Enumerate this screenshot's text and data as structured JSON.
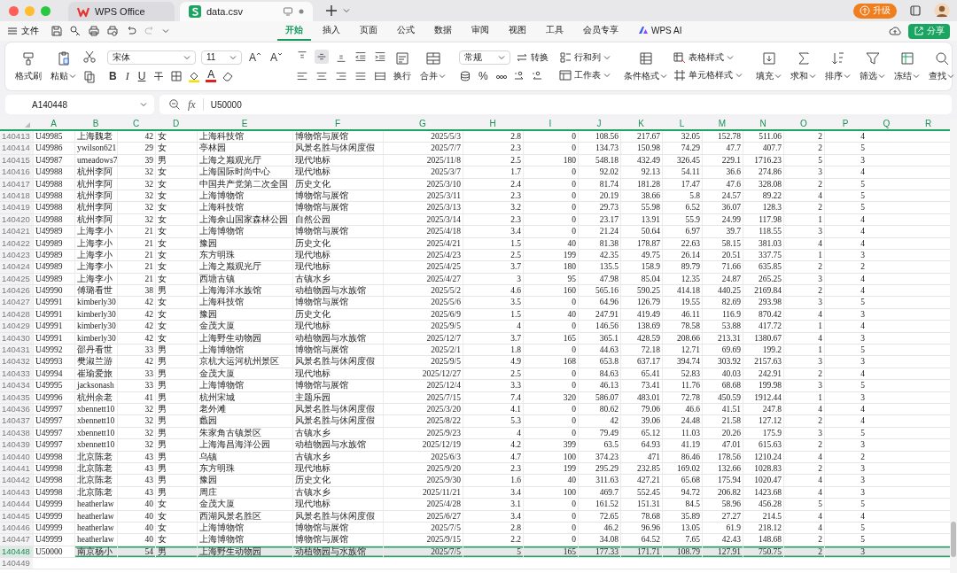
{
  "title_tabs": [
    {
      "label": "WPS Office",
      "selected": false
    },
    {
      "label": "data.csv",
      "selected": true
    }
  ],
  "upgrade": "升级",
  "menu": {
    "file": "文件",
    "tabs": [
      {
        "label": "开始",
        "selected": true
      },
      {
        "label": "插入",
        "selected": false
      },
      {
        "label": "页面",
        "selected": false
      },
      {
        "label": "公式",
        "selected": false
      },
      {
        "label": "数据",
        "selected": false
      },
      {
        "label": "审阅",
        "selected": false
      },
      {
        "label": "视图",
        "selected": false
      },
      {
        "label": "工具",
        "selected": false
      },
      {
        "label": "会员专享",
        "selected": false
      },
      {
        "label": "WPS AI",
        "selected": false
      }
    ],
    "share": "分享"
  },
  "ribbon": {
    "format_painter": "格式刷",
    "paste": "粘贴",
    "font": "宋体",
    "font_size": "11",
    "font_grow": "A",
    "font_shrink": "A",
    "bold": "B",
    "italic": "I",
    "underline": "U",
    "font_color": "A",
    "alignment": [
      {
        "selected": false
      },
      {
        "selected": true
      },
      {
        "selected": false
      },
      {
        "selected": false
      },
      {
        "selected": false
      },
      {
        "selected": false
      },
      {
        "selected": false
      },
      {
        "selected": false
      },
      {
        "selected": false
      },
      {
        "selected": false
      }
    ],
    "wrap": "换行",
    "merge": "合并",
    "number_format": "常规",
    "convert": "转换",
    "percent": "%",
    "rows_cols": "行和列",
    "worksheet": "工作表",
    "cond_format": "条件格式",
    "table_style": "表格样式",
    "cell_style": "单元格样式",
    "fill": "填充",
    "sum": "求和",
    "sort": "排序",
    "filter": "筛选",
    "freeze": "冻结",
    "find": "查找"
  },
  "formula_bar": {
    "cell_ref": "A140448",
    "fx": "fx",
    "value": "U50000"
  },
  "sheet": {
    "columns": [
      "A",
      "B",
      "C",
      "D",
      "E",
      "F",
      "G",
      "H",
      "I",
      "J",
      "K",
      "L",
      "M",
      "N",
      "O",
      "P",
      "Q",
      "R"
    ],
    "rows": [
      {
        "num": "140413",
        "selected": false,
        "cells": [
          "U49985",
          "上海魏老",
          "42",
          "女",
          "上海科技馆",
          "博物馆与展馆",
          "2025/5/3",
          "2.8",
          "0",
          "108.56",
          "217.67",
          "32.05",
          "152.78",
          "511.06",
          "2",
          "4"
        ]
      },
      {
        "num": "140414",
        "selected": false,
        "cells": [
          "U49986",
          "ywilson621",
          "29",
          "女",
          "亭林园",
          "风景名胜与休闲度假",
          "2025/7/7",
          "2.3",
          "0",
          "134.73",
          "150.98",
          "74.29",
          "47.7",
          "407.7",
          "2",
          "5"
        ]
      },
      {
        "num": "140415",
        "selected": false,
        "cells": [
          "U49987",
          "umeadows7",
          "39",
          "男",
          "上海之巅观光厅",
          "现代地标",
          "2025/11/8",
          "2.5",
          "180",
          "548.18",
          "432.49",
          "326.45",
          "229.1",
          "1716.23",
          "5",
          "3"
        ]
      },
      {
        "num": "140416",
        "selected": false,
        "cells": [
          "U49988",
          "杭州李阿",
          "32",
          "女",
          "上海国际时尚中心",
          "现代地标",
          "2025/3/7",
          "1.7",
          "0",
          "92.02",
          "92.13",
          "54.11",
          "36.6",
          "274.86",
          "3",
          "4"
        ]
      },
      {
        "num": "140417",
        "selected": false,
        "cells": [
          "U49988",
          "杭州李阿",
          "32",
          "女",
          "中国共产党第二次全国",
          "历史文化",
          "2025/3/10",
          "2.4",
          "0",
          "81.74",
          "181.28",
          "17.47",
          "47.6",
          "328.08",
          "2",
          "5"
        ]
      },
      {
        "num": "140418",
        "selected": false,
        "cells": [
          "U49988",
          "杭州李阿",
          "32",
          "女",
          "上海博物馆",
          "博物馆与展馆",
          "2025/3/11",
          "2.3",
          "0",
          "20.19",
          "38.66",
          "5.8",
          "24.57",
          "89.22",
          "4",
          "5"
        ]
      },
      {
        "num": "140419",
        "selected": false,
        "cells": [
          "U49988",
          "杭州李阿",
          "32",
          "女",
          "上海科技馆",
          "博物馆与展馆",
          "2025/3/13",
          "3.2",
          "0",
          "29.73",
          "55.98",
          "6.52",
          "36.07",
          "128.3",
          "2",
          "5"
        ]
      },
      {
        "num": "140420",
        "selected": false,
        "cells": [
          "U49988",
          "杭州李阿",
          "32",
          "女",
          "上海佘山国家森林公园",
          "自然公园",
          "2025/3/14",
          "2.3",
          "0",
          "23.17",
          "13.91",
          "55.9",
          "24.99",
          "117.98",
          "1",
          "4"
        ]
      },
      {
        "num": "140421",
        "selected": false,
        "cells": [
          "U49989",
          "上海李小",
          "21",
          "女",
          "上海博物馆",
          "博物馆与展馆",
          "2025/4/18",
          "3.4",
          "0",
          "21.24",
          "50.64",
          "6.97",
          "39.7",
          "118.55",
          "3",
          "4"
        ]
      },
      {
        "num": "140422",
        "selected": false,
        "cells": [
          "U49989",
          "上海李小",
          "21",
          "女",
          "豫园",
          "历史文化",
          "2025/4/21",
          "1.5",
          "40",
          "81.38",
          "178.87",
          "22.63",
          "58.15",
          "381.03",
          "4",
          "4"
        ]
      },
      {
        "num": "140423",
        "selected": false,
        "cells": [
          "U49989",
          "上海李小",
          "21",
          "女",
          "东方明珠",
          "现代地标",
          "2025/4/23",
          "2.5",
          "199",
          "42.35",
          "49.75",
          "26.14",
          "20.51",
          "337.75",
          "1",
          "3"
        ]
      },
      {
        "num": "140424",
        "selected": false,
        "cells": [
          "U49989",
          "上海李小",
          "21",
          "女",
          "上海之巅观光厅",
          "现代地标",
          "2025/4/25",
          "3.7",
          "180",
          "135.5",
          "158.9",
          "89.79",
          "71.66",
          "635.85",
          "2",
          "2"
        ]
      },
      {
        "num": "140425",
        "selected": false,
        "cells": [
          "U49989",
          "上海李小",
          "21",
          "女",
          "西塘古镇",
          "古镇水乡",
          "2025/4/27",
          "3",
          "95",
          "47.98",
          "85.04",
          "12.35",
          "24.87",
          "265.25",
          "3",
          "4"
        ]
      },
      {
        "num": "140426",
        "selected": false,
        "cells": [
          "U49990",
          "傅璐看世",
          "38",
          "男",
          "上海海洋水族馆",
          "动植物园与水族馆",
          "2025/5/2",
          "4.6",
          "160",
          "565.16",
          "590.25",
          "414.18",
          "440.25",
          "2169.84",
          "2",
          "4"
        ]
      },
      {
        "num": "140427",
        "selected": false,
        "cells": [
          "U49991",
          "kimberly30",
          "42",
          "女",
          "上海科技馆",
          "博物馆与展馆",
          "2025/5/6",
          "3.5",
          "0",
          "64.96",
          "126.79",
          "19.55",
          "82.69",
          "293.98",
          "3",
          "5"
        ]
      },
      {
        "num": "140428",
        "selected": false,
        "cells": [
          "U49991",
          "kimberly30",
          "42",
          "女",
          "豫园",
          "历史文化",
          "2025/6/9",
          "1.5",
          "40",
          "247.91",
          "419.49",
          "46.11",
          "116.9",
          "870.42",
          "4",
          "3"
        ]
      },
      {
        "num": "140429",
        "selected": false,
        "cells": [
          "U49991",
          "kimberly30",
          "42",
          "女",
          "金茂大厦",
          "现代地标",
          "2025/9/5",
          "4",
          "0",
          "146.56",
          "138.69",
          "78.58",
          "53.88",
          "417.72",
          "1",
          "4"
        ]
      },
      {
        "num": "140430",
        "selected": false,
        "cells": [
          "U49991",
          "kimberly30",
          "42",
          "女",
          "上海野生动物园",
          "动植物园与水族馆",
          "2025/12/7",
          "3.7",
          "165",
          "365.1",
          "428.59",
          "208.66",
          "213.31",
          "1380.67",
          "4",
          "3"
        ]
      },
      {
        "num": "140431",
        "selected": false,
        "cells": [
          "U49992",
          "邵丹看世",
          "33",
          "男",
          "上海博物馆",
          "博物馆与展馆",
          "2025/2/1",
          "1.8",
          "0",
          "44.63",
          "72.18",
          "12.71",
          "69.69",
          "199.2",
          "1",
          "5"
        ]
      },
      {
        "num": "140432",
        "selected": false,
        "cells": [
          "U49993",
          "樊淑兰游",
          "42",
          "男",
          "京杭大运河杭州景区",
          "风景名胜与休闲度假",
          "2025/9/5",
          "4.9",
          "168",
          "653.8",
          "637.17",
          "394.74",
          "303.92",
          "2157.63",
          "3",
          "3"
        ]
      },
      {
        "num": "140433",
        "selected": false,
        "cells": [
          "U49994",
          "崔瑜爱旅",
          "33",
          "男",
          "金茂大厦",
          "现代地标",
          "2025/12/27",
          "2.5",
          "0",
          "84.63",
          "65.41",
          "52.83",
          "40.03",
          "242.91",
          "2",
          "4"
        ]
      },
      {
        "num": "140434",
        "selected": false,
        "cells": [
          "U49995",
          "jacksonash",
          "33",
          "男",
          "上海博物馆",
          "博物馆与展馆",
          "2025/12/4",
          "3.3",
          "0",
          "46.13",
          "73.41",
          "11.76",
          "68.68",
          "199.98",
          "3",
          "5"
        ]
      },
      {
        "num": "140435",
        "selected": false,
        "cells": [
          "U49996",
          "杭州余老",
          "41",
          "男",
          "杭州宋城",
          "主题乐园",
          "2025/7/15",
          "7.4",
          "320",
          "586.07",
          "483.01",
          "72.78",
          "450.59",
          "1912.44",
          "1",
          "3"
        ]
      },
      {
        "num": "140436",
        "selected": false,
        "cells": [
          "U49997",
          "xbennett10",
          "32",
          "男",
          "老外滩",
          "风景名胜与休闲度假",
          "2025/3/20",
          "4.1",
          "0",
          "80.62",
          "79.06",
          "46.6",
          "41.51",
          "247.8",
          "4",
          "4"
        ]
      },
      {
        "num": "140437",
        "selected": false,
        "cells": [
          "U49997",
          "xbennett10",
          "32",
          "男",
          "蠡园",
          "风景名胜与休闲度假",
          "2025/8/22",
          "5.3",
          "0",
          "42",
          "39.06",
          "24.48",
          "21.58",
          "127.12",
          "2",
          "4"
        ]
      },
      {
        "num": "140438",
        "selected": false,
        "cells": [
          "U49997",
          "xbennett10",
          "32",
          "男",
          "朱家角古镇景区",
          "古镇水乡",
          "2025/9/23",
          "4",
          "0",
          "79.49",
          "65.12",
          "11.03",
          "20.26",
          "175.9",
          "3",
          "5"
        ]
      },
      {
        "num": "140439",
        "selected": false,
        "cells": [
          "U49997",
          "xbennett10",
          "32",
          "男",
          "上海海昌海洋公园",
          "动植物园与水族馆",
          "2025/12/19",
          "4.2",
          "399",
          "63.5",
          "64.93",
          "41.19",
          "47.01",
          "615.63",
          "2",
          "3"
        ]
      },
      {
        "num": "140440",
        "selected": false,
        "cells": [
          "U49998",
          "北京陈老",
          "43",
          "男",
          "乌镇",
          "古镇水乡",
          "2025/6/3",
          "4.7",
          "100",
          "374.23",
          "471",
          "86.46",
          "178.56",
          "1210.24",
          "4",
          "2"
        ]
      },
      {
        "num": "140441",
        "selected": false,
        "cells": [
          "U49998",
          "北京陈老",
          "43",
          "男",
          "东方明珠",
          "现代地标",
          "2025/9/20",
          "2.3",
          "199",
          "295.29",
          "232.85",
          "169.02",
          "132.66",
          "1028.83",
          "2",
          "3"
        ]
      },
      {
        "num": "140442",
        "selected": false,
        "cells": [
          "U49998",
          "北京陈老",
          "43",
          "男",
          "豫园",
          "历史文化",
          "2025/9/30",
          "1.6",
          "40",
          "311.63",
          "427.21",
          "65.68",
          "175.94",
          "1020.47",
          "4",
          "3"
        ]
      },
      {
        "num": "140443",
        "selected": false,
        "cells": [
          "U49998",
          "北京陈老",
          "43",
          "男",
          "周庄",
          "古镇水乡",
          "2025/11/21",
          "3.4",
          "100",
          "469.7",
          "552.45",
          "94.72",
          "206.82",
          "1423.68",
          "4",
          "3"
        ]
      },
      {
        "num": "140444",
        "selected": false,
        "cells": [
          "U49999",
          "heatherlaw",
          "40",
          "女",
          "金茂大厦",
          "现代地标",
          "2025/4/28",
          "3.1",
          "0",
          "161.52",
          "151.31",
          "84.5",
          "58.96",
          "456.28",
          "5",
          "5"
        ]
      },
      {
        "num": "140445",
        "selected": false,
        "cells": [
          "U49999",
          "heatherlaw",
          "40",
          "女",
          "西湖风景名胜区",
          "风景名胜与休闲度假",
          "2025/6/27",
          "3.4",
          "0",
          "72.65",
          "78.68",
          "35.89",
          "27.27",
          "214.5",
          "4",
          "4"
        ]
      },
      {
        "num": "140446",
        "selected": false,
        "cells": [
          "U49999",
          "heatherlaw",
          "40",
          "女",
          "上海博物馆",
          "博物馆与展馆",
          "2025/7/5",
          "2.8",
          "0",
          "46.2",
          "96.96",
          "13.05",
          "61.9",
          "218.12",
          "4",
          "5"
        ]
      },
      {
        "num": "140447",
        "selected": false,
        "cells": [
          "U49999",
          "heatherlaw",
          "40",
          "女",
          "上海博物馆",
          "博物馆与展馆",
          "2025/9/15",
          "2.2",
          "0",
          "34.08",
          "64.52",
          "7.65",
          "42.43",
          "148.68",
          "2",
          "5"
        ]
      },
      {
        "num": "140448",
        "selected": true,
        "cells": [
          "U50000",
          "南京杨小",
          "54",
          "男",
          "上海野生动物园",
          "动植物园与水族馆",
          "2025/7/5",
          "5",
          "165",
          "177.33",
          "171.71",
          "108.79",
          "127.91",
          "750.75",
          "2",
          "3"
        ]
      },
      {
        "num": "140449",
        "selected": false,
        "cells": []
      }
    ]
  }
}
